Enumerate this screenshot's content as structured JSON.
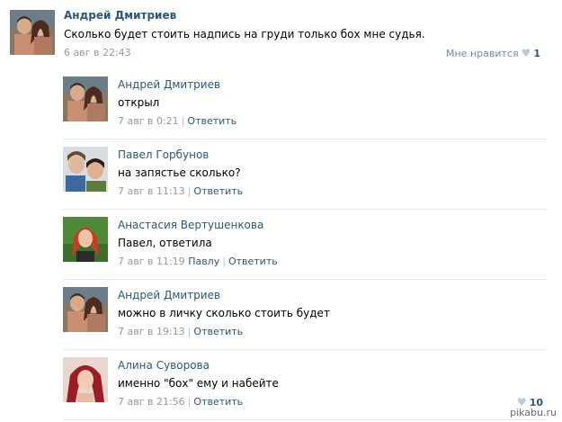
{
  "post": {
    "author": "Андрей Дмитриев",
    "text": "Сколько будет стоить надпись на груди только бох мне судья.",
    "date": "6 авг в 22:43",
    "like_label": "Мне нравится",
    "like_count": "1"
  },
  "replies": [
    {
      "author": "Андрей Дмитриев",
      "text": "открыл",
      "date": "7 авг в 0:21",
      "to": "",
      "reply_label": "Ответить"
    },
    {
      "author": "Павел Горбунов",
      "text": "на запястье сколько?",
      "date": "7 авг в 11:13",
      "to": "",
      "reply_label": "Ответить"
    },
    {
      "author": "Анастасия Вертушенкова",
      "text": "Павел, ответила",
      "date": "7 авг в 11:19",
      "to": "Павлу",
      "reply_label": "Ответить"
    },
    {
      "author": "Андрей Дмитриев",
      "text": "можно в личку сколько стоить будет",
      "date": "7 авг в 19:13",
      "to": "",
      "reply_label": "Ответить"
    },
    {
      "author": "Алина Суворова",
      "text": "именно \"бох\" ему и набейте",
      "date": "7 авг в 21:56",
      "to": "",
      "reply_label": "Ответить",
      "like_count": "10"
    }
  ],
  "watermark": "pikabu.ru",
  "colors": {
    "link": "#2b587a",
    "meta": "#999999",
    "divider": "#e7eaed",
    "heart": "#b9c9d8"
  }
}
